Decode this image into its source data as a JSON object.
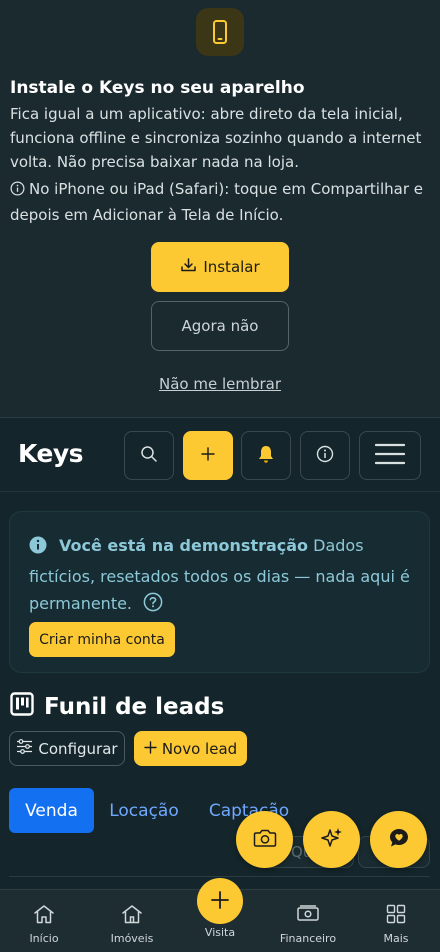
{
  "install_banner": {
    "title": "Instale o Keys no seu aparelho",
    "description": "Fica igual a um aplicativo: abre direto da tela inicial, funciona offline e sincroniza sozinho quando a internet volta. Não precisa baixar nada na loja.",
    "ios_hint": "No iPhone ou iPad (Safari): toque em Compartilhar e depois em Adicionar à Tela de Início.",
    "install_label": "Instalar",
    "later_label": "Agora não",
    "dont_remind_label": "Não me lembrar"
  },
  "header": {
    "logo": "Keys"
  },
  "demo_notice": {
    "title": "Você está na demonstração",
    "text": "Dados fictícios, resetados todos os dias — nada aqui é permanente.",
    "cta_label": "Criar minha conta"
  },
  "funnel": {
    "title": "Funil de leads",
    "configure_label": "Configurar",
    "new_lead_label": "Novo lead",
    "tabs": [
      {
        "label": "Venda",
        "active": true
      },
      {
        "label": "Locação",
        "active": false
      },
      {
        "label": "Captação",
        "active": false
      }
    ],
    "partial_chip": "Qu"
  },
  "bottom_nav": {
    "items": [
      {
        "label": "Início",
        "icon": "home-icon"
      },
      {
        "label": "Imóveis",
        "icon": "house-icon"
      },
      {
        "label": "Visita",
        "icon": "plus-icon"
      },
      {
        "label": "Financeiro",
        "icon": "money-icon"
      },
      {
        "label": "Mais",
        "icon": "grid-icon"
      }
    ]
  },
  "colors": {
    "accent": "#fcc933",
    "active_tab": "#1370f0",
    "info_text": "#8dc8d8",
    "background": "#14262b"
  }
}
